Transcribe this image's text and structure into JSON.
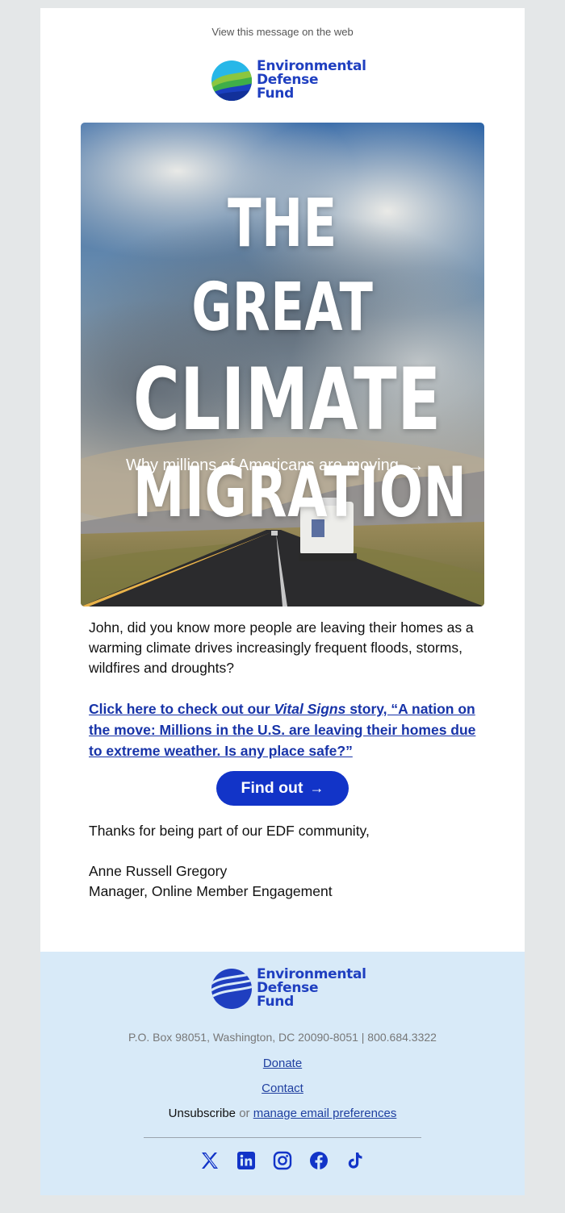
{
  "header": {
    "view_web": "View this message on the web",
    "logo_lines": [
      "Environmental",
      "Defense",
      "Fund"
    ]
  },
  "hero": {
    "title_lines": [
      "THE GREAT",
      "CLIMATE",
      "MIGRATION"
    ],
    "subtitle": "Why millions of Americans are moving",
    "arrow": "→"
  },
  "body": {
    "intro": "John, did you know more people are leaving their homes as a warming climate drives increasingly frequent floods, storms, wildfires and droughts?",
    "link_prefix": "Click here to check out our ",
    "link_italic": "Vital Signs",
    "link_suffix": " story, “A nation on the move: Millions in the U.S. are leaving their homes due to extreme weather. Is any place safe?”",
    "cta_label": "Find out",
    "cta_arrow": "→",
    "thanks": "Thanks for being part of our EDF community,",
    "signature_name": "Anne Russell Gregory",
    "signature_title": "Manager, Online Member Engagement"
  },
  "footer": {
    "logo_lines": [
      "Environmental",
      "Defense",
      "Fund"
    ],
    "address": "P.O. Box 98051, Washington, DC 20090-8051 | 800.684.3322",
    "donate": "Donate",
    "contact": "Contact",
    "unsubscribe": "Unsubscribe",
    "or": "or",
    "manage": "manage email preferences",
    "social": [
      "x-icon",
      "linkedin-icon",
      "instagram-icon",
      "facebook-icon",
      "tiktok-icon"
    ]
  },
  "colors": {
    "brand_blue": "#1234c8",
    "link_blue": "#1733a8",
    "footer_bg": "#d8eaf8",
    "page_bg": "#e4e7e8"
  }
}
